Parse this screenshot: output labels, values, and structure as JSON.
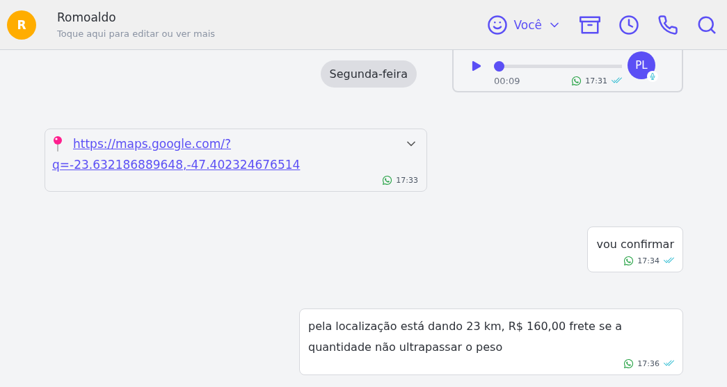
{
  "contact": {
    "initial": "R",
    "name": "Romoaldo",
    "subtitle": "Toque aqui para editar ou ver mais"
  },
  "toolbar": {
    "agent_label": "Você"
  },
  "day_separator": "Segunda-feira",
  "messages": [
    {
      "kind": "audio",
      "duration": "00:09",
      "level": 0,
      "time": "17:31",
      "read": true,
      "sender_initials": "PL"
    },
    {
      "kind": "location",
      "link_lines": [
        "https://maps.google.com/?",
        "q=-23.632186889648,-47.402324676514"
      ],
      "time": "17:33"
    },
    {
      "kind": "text",
      "text": "vou confirmar",
      "time": "17:34",
      "read": true
    },
    {
      "kind": "text",
      "text": "pela localização está dando 23 km, R$ 160,00 frete se a quantidade não ultrapassar o peso",
      "time": "17:36",
      "read": true
    }
  ]
}
